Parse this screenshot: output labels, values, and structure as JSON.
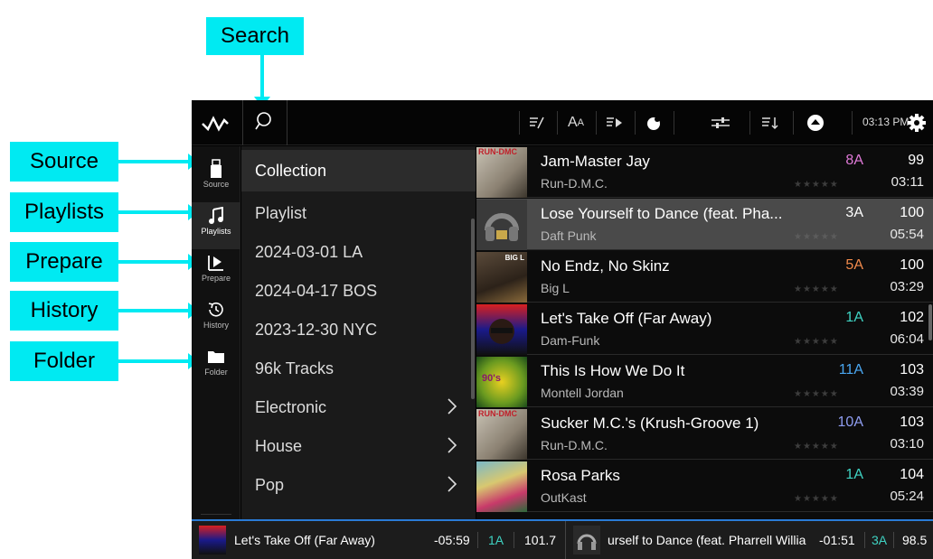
{
  "callouts": {
    "search": "Search",
    "source": "Source",
    "playlists": "Playlists",
    "prepare": "Prepare",
    "history": "History",
    "folder": "Folder"
  },
  "topbar": {
    "clock": "03:13 PM",
    "icons": [
      "logo-icon",
      "search-icon",
      "edit-list-icon",
      "text-size-icon",
      "preview-icon",
      "color-icon",
      "filter-icon",
      "sort-icon",
      "eject-icon",
      "gear-icon"
    ]
  },
  "sidebar": {
    "items": [
      {
        "label": "Source",
        "icon": "usb-drive-icon"
      },
      {
        "label": "Playlists",
        "icon": "music-note-icon"
      },
      {
        "label": "Prepare",
        "icon": "prepare-icon"
      },
      {
        "label": "History",
        "icon": "history-clock-icon"
      },
      {
        "label": "Folder",
        "icon": "folder-icon"
      }
    ]
  },
  "categories": [
    {
      "label": "Collection",
      "selected": true,
      "chevron": false
    },
    {
      "label": "Playlist",
      "selected": false,
      "chevron": false
    },
    {
      "label": "2024-03-01 LA",
      "selected": false,
      "chevron": false
    },
    {
      "label": "2024-04-17 BOS",
      "selected": false,
      "chevron": false
    },
    {
      "label": "2023-12-30 NYC",
      "selected": false,
      "chevron": false
    },
    {
      "label": "96k Tracks",
      "selected": false,
      "chevron": false
    },
    {
      "label": "Electronic",
      "selected": false,
      "chevron": true
    },
    {
      "label": "House",
      "selected": false,
      "chevron": true
    },
    {
      "label": "Pop",
      "selected": false,
      "chevron": true
    }
  ],
  "tracks": [
    {
      "title": "Jam-Master Jay",
      "artist": "Run-D.M.C.",
      "key": "8A",
      "key_color": "#e07ad8",
      "bpm": "99",
      "time": "03:11",
      "stars": "★★★★★",
      "highlight": false
    },
    {
      "title": "Lose Yourself to Dance (feat. Pha...",
      "artist": "Daft Punk",
      "key": "3A",
      "key_color": "#ffffff",
      "bpm": "100",
      "time": "05:54",
      "stars": "★★★★★",
      "highlight": true
    },
    {
      "title": "No Endz, No Skinz",
      "artist": "Big L",
      "key": "5A",
      "key_color": "#f08a4b",
      "bpm": "100",
      "time": "03:29",
      "stars": "★★★★★",
      "highlight": false
    },
    {
      "title": "Let's Take Off (Far Away)",
      "artist": "Dam-Funk",
      "key": "1A",
      "key_color": "#3fd3c3",
      "bpm": "102",
      "time": "06:04",
      "stars": "★★★★★",
      "highlight": false
    },
    {
      "title": "This Is How We Do It",
      "artist": "Montell Jordan",
      "key": "11A",
      "key_color": "#4aa6f0",
      "bpm": "103",
      "time": "03:39",
      "stars": "★★★★★",
      "highlight": false
    },
    {
      "title": "Sucker M.C.'s (Krush-Groove 1)",
      "artist": "Run-D.M.C.",
      "key": "10A",
      "key_color": "#8f9df0",
      "bpm": "103",
      "time": "03:10",
      "stars": "★★★★★",
      "highlight": false
    },
    {
      "title": "Rosa Parks",
      "artist": "OutKast",
      "key": "1A",
      "key_color": "#3fd3c3",
      "bpm": "104",
      "time": "05:24",
      "stars": "★★★★★",
      "highlight": false
    }
  ],
  "decks": [
    {
      "title": "Let's Take Off (Far Away)",
      "time": "-05:59",
      "key": "1A",
      "bpm": "101.7"
    },
    {
      "title": "urself to Dance (feat. Pharrell Willia",
      "time": "-01:51",
      "key": "3A",
      "bpm": "98.5"
    }
  ],
  "colors": {
    "callout": "#00eaf2",
    "accent": "#2a7bd6"
  }
}
